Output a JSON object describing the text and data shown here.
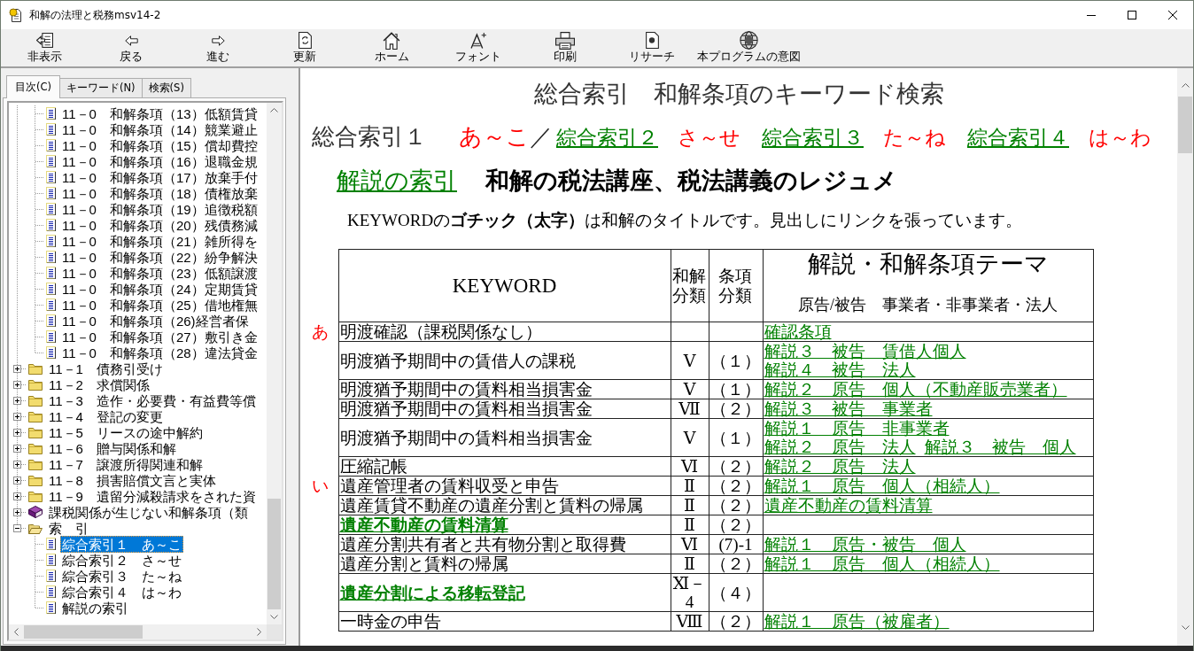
{
  "window": {
    "title": "和解の法理と税務msv14-2"
  },
  "toolbar": [
    "非表示",
    "戻る",
    "進む",
    "更新",
    "ホーム",
    "フォント",
    "印刷",
    "リサーチ",
    "本プログラムの意図"
  ],
  "tabs": [
    {
      "label": "目次(C)",
      "selected": true
    },
    {
      "label": "キーワード(N)",
      "selected": false
    },
    {
      "label": "検索(S)",
      "selected": false
    }
  ],
  "tree": {
    "items": [
      {
        "children": [
          {
            "kind": "page",
            "label": "11－0　和解条項（13）低額賃貸",
            "selected": false
          },
          {
            "kind": "page",
            "label": "11－0　和解条項（14）競業避止",
            "selected": false
          },
          {
            "kind": "page",
            "label": "11－0　和解条項（15）償却費控",
            "selected": false
          },
          {
            "kind": "page",
            "label": "11－0　和解条項（16）退職金規",
            "selected": false
          },
          {
            "kind": "page",
            "label": "11－0　和解条項（17）放棄手付",
            "selected": false
          },
          {
            "kind": "page",
            "label": "11－0　和解条項（18）債権放棄",
            "selected": false
          },
          {
            "kind": "page",
            "label": "11－0　和解条項（19）追徴税額",
            "selected": false
          },
          {
            "kind": "page",
            "label": "11－0　和解条項（20）残債務減",
            "selected": false
          },
          {
            "kind": "page",
            "label": "11－0　和解条項（21）雑所得を",
            "selected": false
          },
          {
            "kind": "page",
            "label": "11－0　和解条項（22）紛争解決",
            "selected": false
          },
          {
            "kind": "page",
            "label": "11－0　和解条項（23）低額譲渡",
            "selected": false
          },
          {
            "kind": "page",
            "label": "11－0　和解条項（24）定期賃貸",
            "selected": false
          },
          {
            "kind": "page",
            "label": "11－0　和解条項（25）借地権無",
            "selected": false
          },
          {
            "kind": "page",
            "label": "11－0　和解条項（26)経営者保",
            "selected": false
          },
          {
            "kind": "page",
            "label": "11－0　和解条項（27）敷引き金",
            "selected": false
          },
          {
            "kind": "page",
            "label": "11－0　和解条項（28）違法貸金",
            "selected": false
          }
        ]
      },
      {
        "kind": "folder",
        "label": "11－1　債務引受け",
        "expanded": false,
        "selected": false
      },
      {
        "kind": "folder",
        "label": "11－2　求償関係",
        "expanded": false,
        "selected": false
      },
      {
        "kind": "folder",
        "label": "11－3　造作・必要費・有益費等償",
        "expanded": false,
        "selected": false
      },
      {
        "kind": "folder",
        "label": "11－4　登記の変更",
        "expanded": false,
        "selected": false
      },
      {
        "kind": "folder",
        "label": "11－5　リースの途中解約",
        "expanded": false,
        "selected": false
      },
      {
        "kind": "folder",
        "label": "11－6　贈与関係和解",
        "expanded": false,
        "selected": false
      },
      {
        "kind": "folder",
        "label": "11－7　譲渡所得関連和解",
        "expanded": false,
        "selected": false
      },
      {
        "kind": "folder",
        "label": "11－8　損害賠償文言と実体",
        "expanded": false,
        "selected": false
      },
      {
        "kind": "folder",
        "label": "11－9　遺留分減殺請求をされた資",
        "expanded": false,
        "selected": false
      },
      {
        "kind": "book",
        "label": "課税関係が生じない和解条項（類",
        "expanded": false,
        "selected": false
      },
      {
        "kind": "folder",
        "label": "索　引",
        "expanded": true,
        "selected": false,
        "children": [
          {
            "kind": "page",
            "label": "綜合索引１　あ～こ",
            "selected": true
          },
          {
            "kind": "page",
            "label": "綜合索引２　さ～せ",
            "selected": false
          },
          {
            "kind": "page",
            "label": "綜合索引３　た～ね",
            "selected": false
          },
          {
            "kind": "page",
            "label": "綜合索引４　は～わ",
            "selected": false
          },
          {
            "kind": "page",
            "label": "解説の索引",
            "selected": false
          }
        ]
      }
    ]
  },
  "page": {
    "title": "総合索引　和解条項のキーワード検索",
    "nav": {
      "current": "総合索引１",
      "range": "あ～こ",
      "separator": "／",
      "others": [
        {
          "link": "綜合索引２",
          "range": "さ～せ"
        },
        {
          "link": "綜合索引３",
          "range": "た～ね"
        },
        {
          "link": "綜合索引４",
          "range": "は～わ"
        }
      ]
    },
    "subheading": {
      "link": "解説の索引",
      "title": "和解の税法講座、税法講義のレジュメ"
    },
    "note": "KEYWORDの**ゴチック（太字）**は和解のタイトルです。見出しにリンクを張っています。",
    "table": {
      "columns": [
        "KEYWORD",
        "和解分類",
        "条項分類"
      ],
      "theme_column": {
        "title": "解説・和解条項テーマ",
        "subtitle": "原告/被告　事業者・非事業者・法人"
      },
      "rows": [
        {
          "index": "あ",
          "kind": "plain",
          "keyword": "明渡確認（課税関係なし）",
          "links": [
            "確認条項"
          ]
        },
        {
          "kind": "plain",
          "keyword": "明渡猶予期間中の賃借人の課税",
          "category": "Ⅴ",
          "clause": "（１）",
          "links": [
            "解説３　被告　賃借人個人",
            "解説４　被告　法人"
          ]
        },
        {
          "kind": "plain",
          "keyword": "明渡猶予期間中の賃料相当損害金",
          "category": "Ⅴ",
          "clause": "（１）",
          "links": [
            "解説２　原告　個人（不動産販売業者）"
          ]
        },
        {
          "kind": "plain",
          "keyword": "明渡猶予期間中の賃料相当損害金",
          "category": "Ⅶ",
          "clause": "（２）",
          "links": [
            "解説３　被告　事業者"
          ]
        },
        {
          "kind": "plain",
          "keyword": "明渡猶予期間中の賃料相当損害金",
          "category": "Ⅴ",
          "clause": "（１）",
          "links": [
            "解説１　原告　非事業者",
            "解説２　原告　法人",
            "解説３　被告　個人"
          ]
        },
        {
          "kind": "plain",
          "keyword": "圧縮記帳",
          "category": "Ⅵ",
          "clause": "（２）",
          "links": [
            "解説２　原告　法人"
          ]
        },
        {
          "index": "い",
          "kind": "plain",
          "keyword": "遺産管理者の賃料収受と申告",
          "category": "Ⅱ",
          "clause": "（２）",
          "links": [
            "解説１　原告　個人（相続人）"
          ]
        },
        {
          "kind": "plain",
          "keyword": "遺産賃貸不動産の遺産分割と賃料の帰属",
          "category": "Ⅱ",
          "clause": "（２）",
          "links": [
            "遺産不動産の賃料清算"
          ]
        },
        {
          "kind": "title",
          "keyword": "遺産不動産の賃料清算",
          "category": "Ⅱ",
          "clause": "（２）"
        },
        {
          "kind": "plain",
          "keyword": "遺産分割共有者と共有物分割と取得費",
          "category": "Ⅵ",
          "clause": "(7)-1",
          "links": [
            "解説１　原告・被告　個人"
          ]
        },
        {
          "kind": "plain",
          "keyword": "遺産分割と賃料の帰属",
          "category": "Ⅱ",
          "clause": "（２）",
          "links": [
            "解説１　原告　個人（相続人）"
          ]
        },
        {
          "kind": "title",
          "keyword": "遺産分割による移転登記",
          "category": "Ⅺ－4",
          "clause": "（４）"
        },
        {
          "kind": "plain",
          "keyword": "一時金の申告",
          "category": "Ⅷ",
          "clause": "（２）",
          "links": [
            "解説１　原告（被雇者）"
          ]
        }
      ]
    }
  }
}
